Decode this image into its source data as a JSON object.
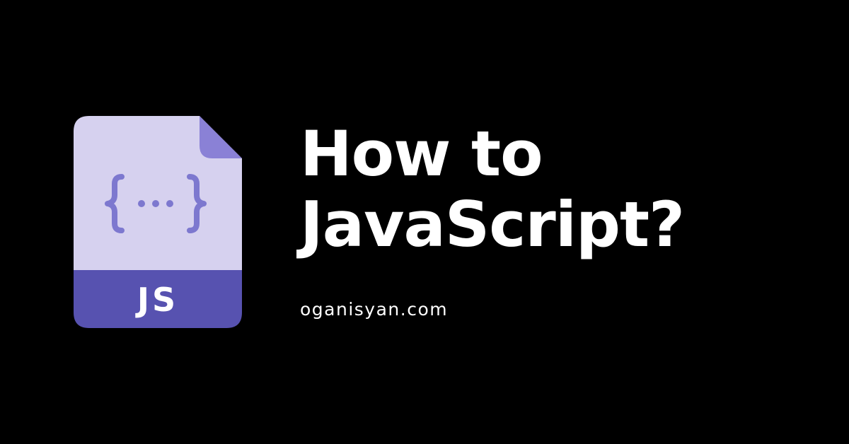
{
  "title": {
    "line1": "How to",
    "line2": "JavaScript?"
  },
  "website": "oganisyan.com",
  "icon": {
    "name": "js-file-icon",
    "label": "JS",
    "glyph": "{...}",
    "colors": {
      "page": "#d6d1ef",
      "fold": "#8a81d6",
      "band": "#5752b0",
      "braces": "#7d78cf",
      "label": "#ffffff"
    }
  },
  "colors": {
    "background": "#000000",
    "text": "#ffffff"
  }
}
